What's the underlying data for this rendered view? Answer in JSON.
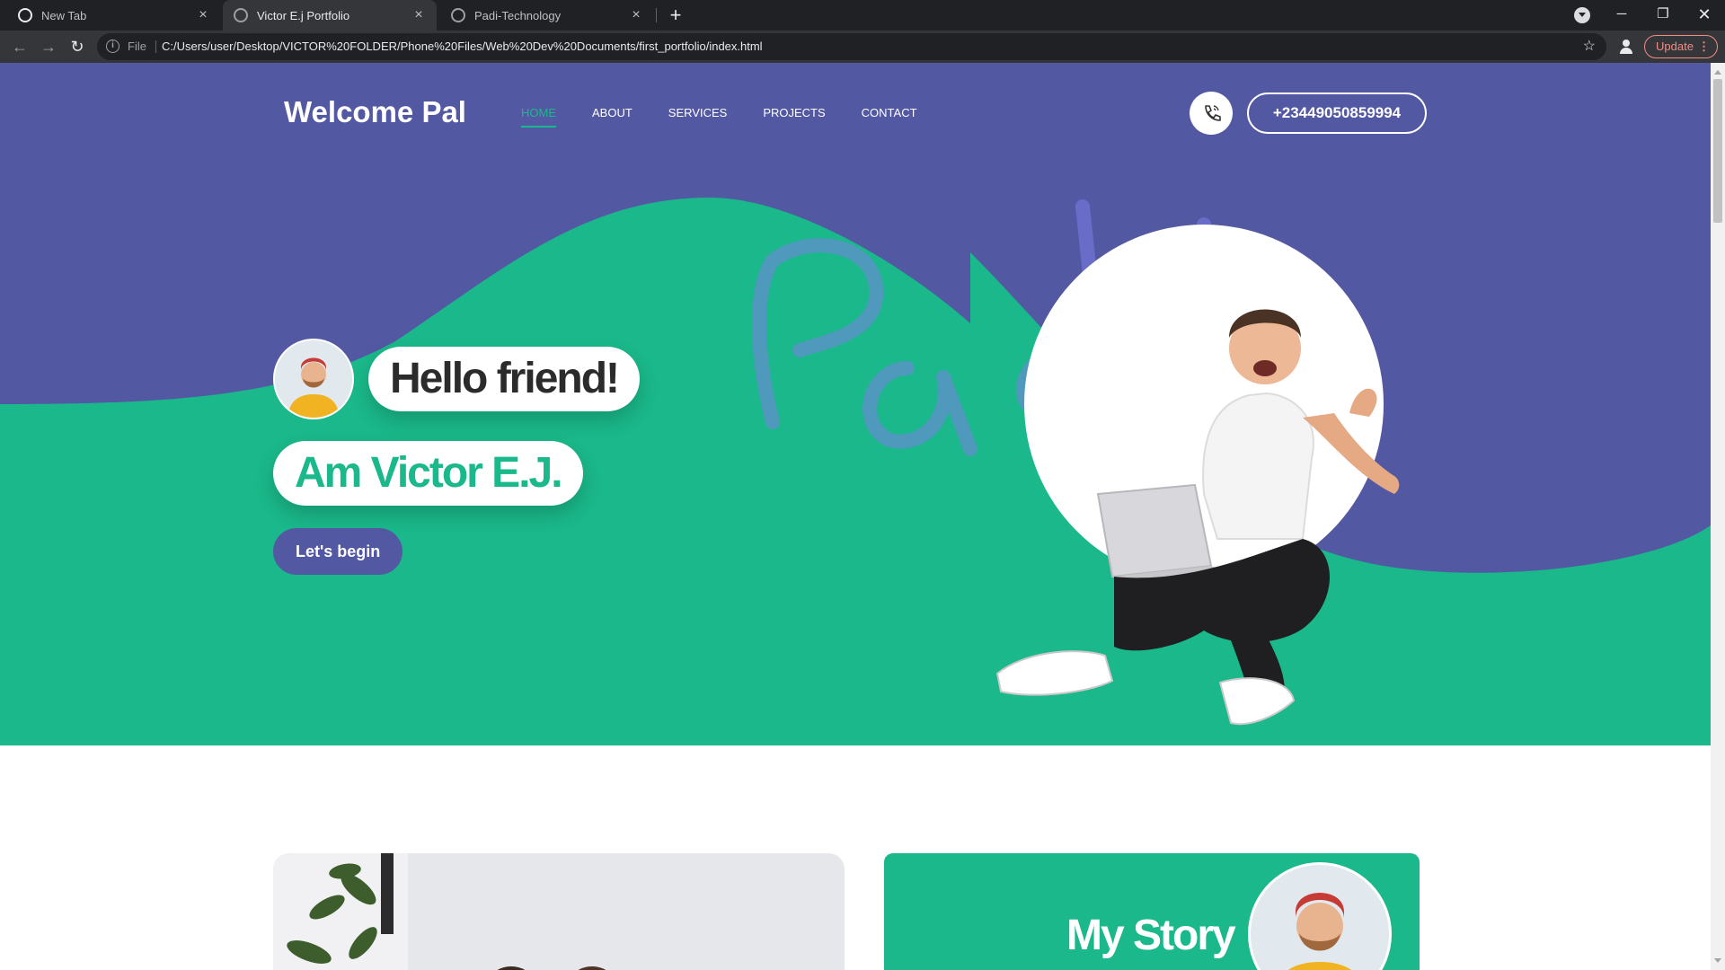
{
  "browser": {
    "tabs": [
      {
        "title": "New Tab"
      },
      {
        "title": "Victor E.j Portfolio"
      },
      {
        "title": "Padi-Technology"
      }
    ],
    "address": {
      "scheme_label": "File",
      "url": "C:/Users/user/Desktop/VICTOR%20FOLDER/Phone%20Files/Web%20Dev%20Documents/first_portfolio/index.html"
    },
    "update_label": "Update"
  },
  "site": {
    "brand": "Welcome Pal",
    "nav": [
      "HOME",
      "ABOUT",
      "SERVICES",
      "PROJECTS",
      "CONTACT"
    ],
    "active_nav": "HOME",
    "phone": "+23449050859994",
    "hero": {
      "greeting": "Hello friend!",
      "name": "Am Victor E.J.",
      "cta": "Let's begin",
      "watermark": "Padi"
    },
    "story_title": "My Story"
  },
  "colors": {
    "hero_green": "#1ab88a",
    "wave_purple": "#5358a3",
    "browser_dark": "#202124"
  },
  "icons": {
    "tabs": [
      "chrome-icon",
      "globe-icon",
      "globe-icon"
    ],
    "call": "phone-call-icon",
    "bookmark": "star-icon"
  }
}
